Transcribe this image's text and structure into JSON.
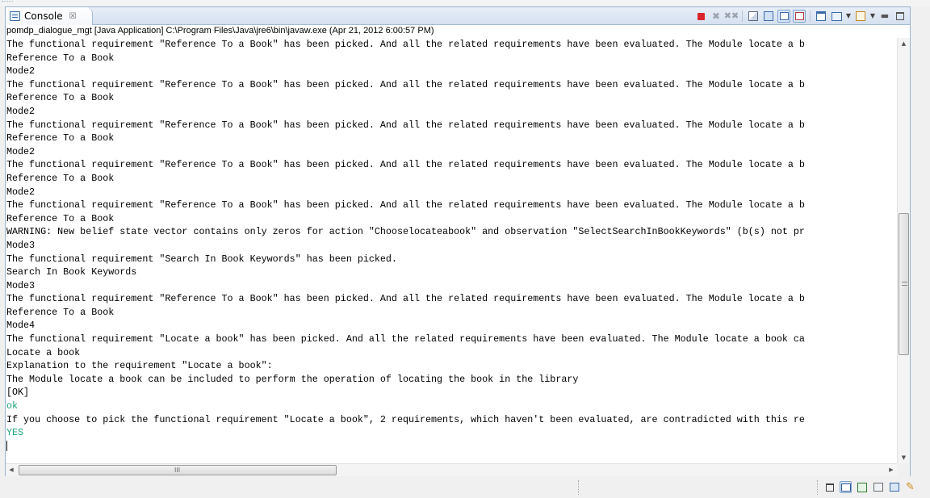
{
  "view": {
    "tab_title": "Console",
    "tab_close_glyph": "☒",
    "header": "pomdp_dialogue_mgt [Java Application] C:\\Program Files\\Java\\jre6\\bin\\javaw.exe (Apr 21, 2012 6:00:57 PM)"
  },
  "toolbar": {
    "icons": [
      "terminate-icon",
      "remove-launch-icon",
      "remove-all-terminated-icon",
      "clear-console-icon",
      "scroll-lock-icon",
      "show-console-on-output-icon",
      "show-console-on-error-icon",
      "pin-console-icon",
      "display-selected-console-icon",
      "open-console-icon",
      "minimize-icon",
      "maximize-icon"
    ],
    "accent_terminate": "#d9252b"
  },
  "console": {
    "lines": [
      {
        "text": "The functional requirement \"Reference To a Book\" has been picked. And all the related requirements have been evaluated. The Module locate a b",
        "type": "output"
      },
      {
        "text": "Reference To a Book",
        "type": "output"
      },
      {
        "text": "Mode2",
        "type": "output"
      },
      {
        "text": "The functional requirement \"Reference To a Book\" has been picked. And all the related requirements have been evaluated. The Module locate a b",
        "type": "output"
      },
      {
        "text": "Reference To a Book",
        "type": "output"
      },
      {
        "text": "Mode2",
        "type": "output"
      },
      {
        "text": "The functional requirement \"Reference To a Book\" has been picked. And all the related requirements have been evaluated. The Module locate a b",
        "type": "output"
      },
      {
        "text": "Reference To a Book",
        "type": "output"
      },
      {
        "text": "Mode2",
        "type": "output"
      },
      {
        "text": "The functional requirement \"Reference To a Book\" has been picked. And all the related requirements have been evaluated. The Module locate a b",
        "type": "output"
      },
      {
        "text": "Reference To a Book",
        "type": "output"
      },
      {
        "text": "Mode2",
        "type": "output"
      },
      {
        "text": "The functional requirement \"Reference To a Book\" has been picked. And all the related requirements have been evaluated. The Module locate a b",
        "type": "output"
      },
      {
        "text": "Reference To a Book",
        "type": "output"
      },
      {
        "text": "WARNING: New belief state vector contains only zeros for action \"Chooselocateabook\" and observation \"SelectSearchInBookKeywords\" (b(s) not pr",
        "type": "output"
      },
      {
        "text": "Mode3",
        "type": "output"
      },
      {
        "text": "The functional requirement \"Search In Book Keywords\" has been picked.",
        "type": "output"
      },
      {
        "text": "Search In Book Keywords",
        "type": "output"
      },
      {
        "text": "Mode3",
        "type": "output"
      },
      {
        "text": "The functional requirement \"Reference To a Book\" has been picked. And all the related requirements have been evaluated. The Module locate a b",
        "type": "output"
      },
      {
        "text": "Reference To a Book",
        "type": "output"
      },
      {
        "text": "Mode4",
        "type": "output"
      },
      {
        "text": "The functional requirement \"Locate a book\" has been picked. And all the related requirements have been evaluated. The Module locate a book ca",
        "type": "output"
      },
      {
        "text": "Locate a book",
        "type": "output"
      },
      {
        "text": "Explanation to the requirement \"Locate a book\":",
        "type": "output"
      },
      {
        "text": "The Module locate a book can be included to perform the operation of locating the book in the library",
        "type": "output"
      },
      {
        "text": "[OK]",
        "type": "output"
      },
      {
        "text": "ok",
        "type": "input"
      },
      {
        "text": "If you choose to pick the functional requirement \"Locate a book\", 2 requirements, which haven't been evaluated, are contradicted with this re",
        "type": "output"
      },
      {
        "text": "YES",
        "type": "input"
      }
    ],
    "input_color": "#1aa37a"
  },
  "scrollbars": {
    "vertical": {
      "position_fraction": 0.63
    },
    "horizontal": {
      "position_fraction": 0.0,
      "thumb_grip": "III"
    }
  },
  "statusbar": {
    "trim_icons": [
      "restore-icon",
      "console-view-icon",
      "tasks-icon",
      "outline-icon",
      "hierarchy-icon",
      "pen-icon"
    ]
  }
}
